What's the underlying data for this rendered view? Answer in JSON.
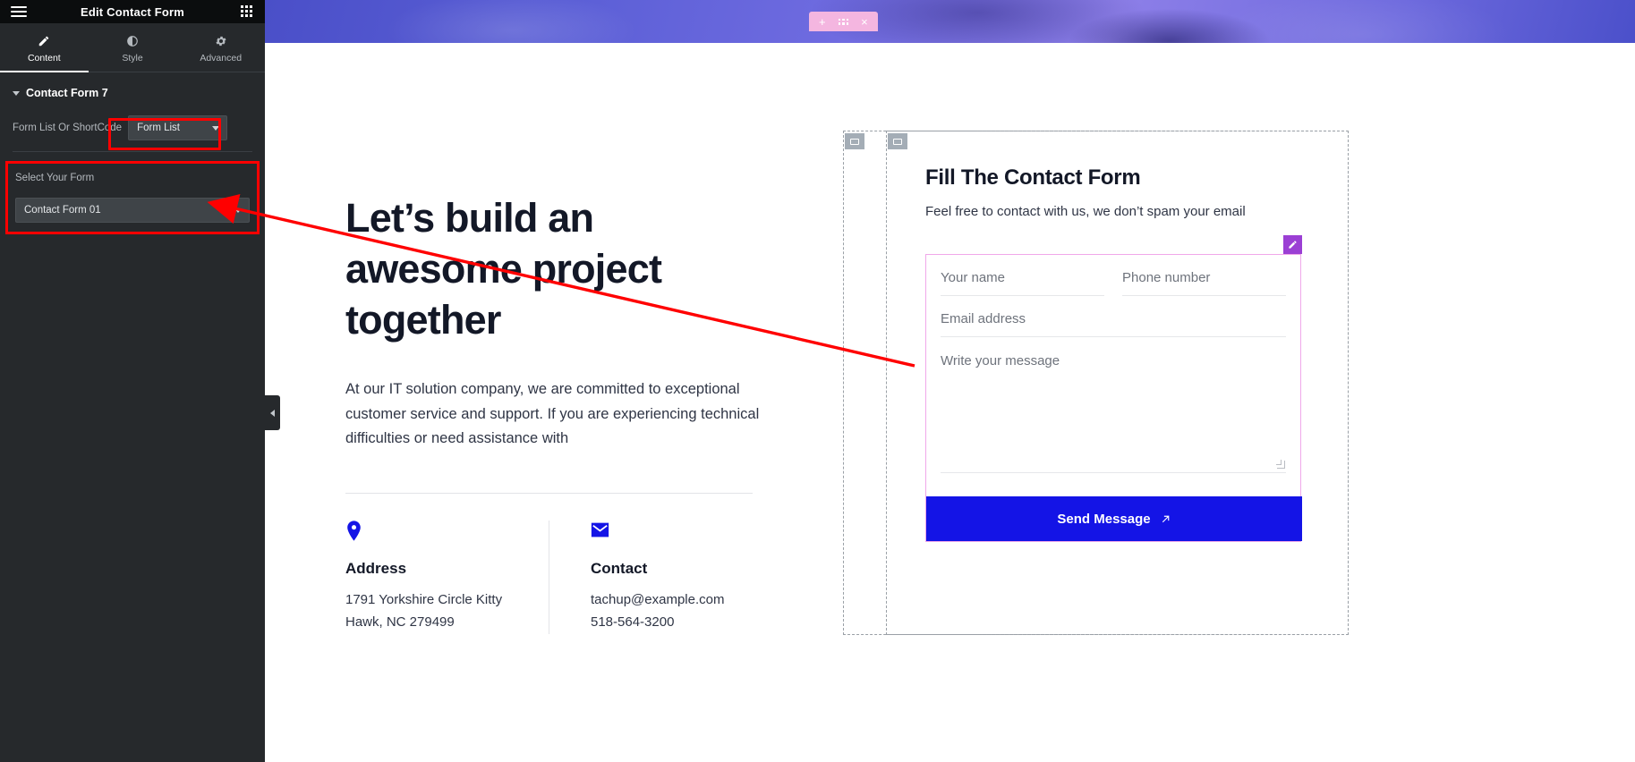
{
  "panel": {
    "title": "Edit Contact Form",
    "menu_icon": "hamburger-icon",
    "apps_icon": "grid-apps-icon",
    "tabs": [
      {
        "label": "Content",
        "icon": "pencil-icon",
        "active": true
      },
      {
        "label": "Style",
        "icon": "contrast-circle-icon",
        "active": false
      },
      {
        "label": "Advanced",
        "icon": "gear-icon",
        "active": false
      }
    ],
    "section": {
      "label": "Contact Form 7"
    },
    "controls": [
      {
        "label": "Form List Or ShortCode",
        "value": "Form List",
        "type": "select"
      },
      {
        "label": "Select Your Form",
        "value": "Contact Form 01",
        "type": "select"
      }
    ],
    "highlight_color": "#ff0000",
    "collapse_icon": "chevron-left-icon"
  },
  "canvas": {
    "section_toolbar": {
      "add": "+",
      "drag": "drag-handle",
      "close": "×",
      "color": "#f4b6e0"
    },
    "hero": {
      "headline": "Let’s build an awesome project together",
      "lede": "At our IT solution company, we are committed to exceptional customer service and support. If you are experiencing technical difficulties or need assistance with"
    },
    "info": [
      {
        "icon": "map-pin-icon",
        "title": "Address",
        "lines": [
          "1791 Yorkshire Circle Kitty",
          "Hawk, NC 279499"
        ]
      },
      {
        "icon": "envelope-icon",
        "title": "Contact",
        "lines": [
          "tachup@example.com",
          "518-564-3200"
        ]
      }
    ],
    "form": {
      "title": "Fill The Contact Form",
      "subtitle": "Feel free to contact with us, we don’t spam your email",
      "edit_icon": "pencil-edit-icon",
      "fields": [
        {
          "name": "your-name",
          "placeholder": "Your name",
          "value": ""
        },
        {
          "name": "phone-number",
          "placeholder": "Phone number",
          "value": ""
        },
        {
          "name": "email-address",
          "placeholder": "Email address",
          "value": ""
        },
        {
          "name": "message",
          "placeholder": "Write your message",
          "value": ""
        }
      ],
      "submit_label": "Send Message",
      "submit_icon": "arrow-up-right-icon",
      "accent_color": "#1414e6",
      "outline_color": "#f0a8ea"
    }
  },
  "annotation": {
    "type": "arrow",
    "color": "#ff0000"
  }
}
